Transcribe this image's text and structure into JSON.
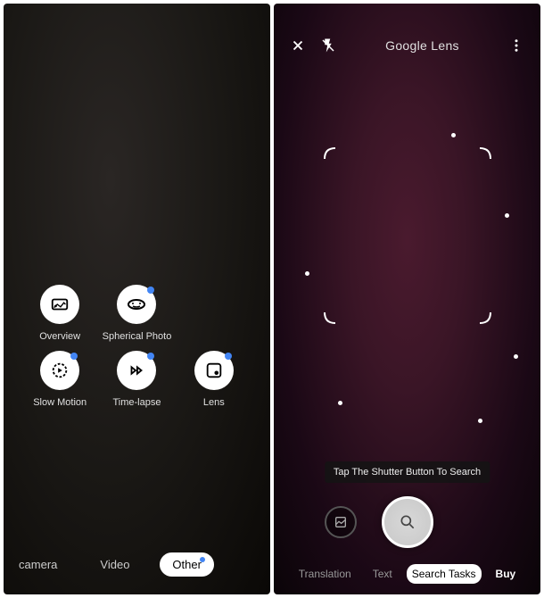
{
  "left": {
    "modes": [
      {
        "label": "Overview",
        "hasBlueDot": false
      },
      {
        "label": "Spherical Photo",
        "hasBlueDot": true
      },
      {
        "label": "Slow Motion",
        "hasBlueDot": true
      },
      {
        "label": "Time-lapse",
        "hasBlueDot": true
      },
      {
        "label": "Lens",
        "hasBlueDot": true
      }
    ],
    "tabs": [
      "camera",
      "Video",
      "Other"
    ],
    "activeTab": "Other"
  },
  "right": {
    "title": "Google Lens",
    "tooltip": "Tap The Shutter Button To Search",
    "tabs": [
      "Translation",
      "Text",
      "Search Tasks",
      "Buy"
    ],
    "activeTab": "Search Tasks"
  }
}
